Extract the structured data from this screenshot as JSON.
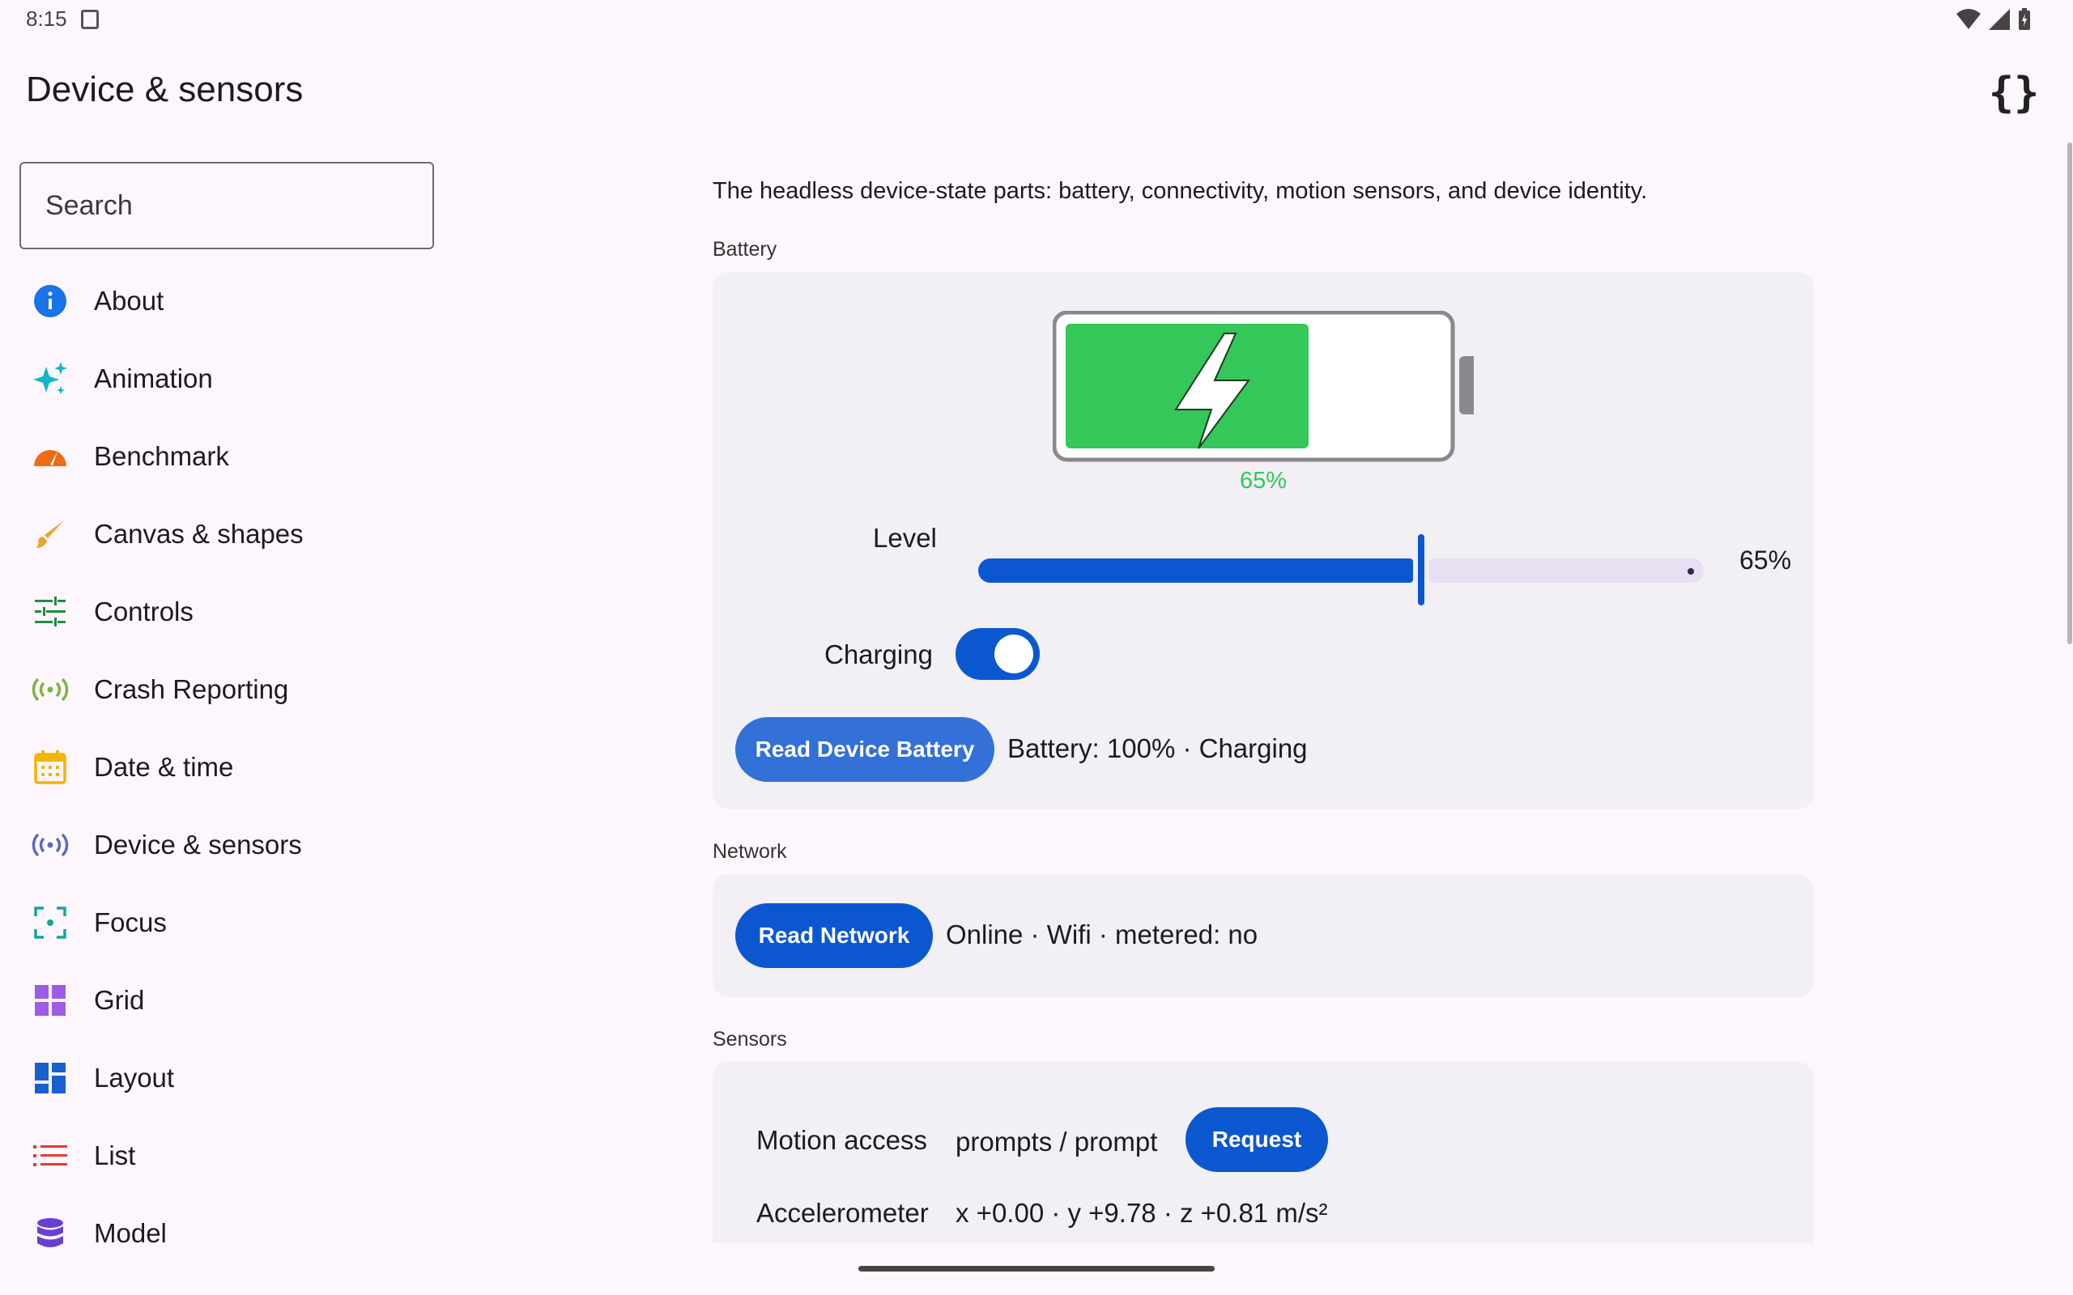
{
  "status_bar": {
    "time": "8:15"
  },
  "app": {
    "title": "Device & sensors"
  },
  "search": {
    "placeholder": "Search"
  },
  "nav": {
    "items": [
      {
        "label": "About",
        "icon": "info-icon",
        "color": "#1a73e8"
      },
      {
        "label": "Animation",
        "icon": "sparkle-icon",
        "color": "#12b5cb"
      },
      {
        "label": "Benchmark",
        "icon": "speedometer-icon",
        "color": "#f06b15"
      },
      {
        "label": "Canvas & shapes",
        "icon": "brush-icon",
        "color": "#f0a030"
      },
      {
        "label": "Controls",
        "icon": "tune-icon",
        "color": "#1e8e3e"
      },
      {
        "label": "Crash Reporting",
        "icon": "broadcast-icon",
        "color": "#7cb342"
      },
      {
        "label": "Date & time",
        "icon": "calendar-icon",
        "color": "#f4b400"
      },
      {
        "label": "Device & sensors",
        "icon": "sensors-icon",
        "color": "#5c6bc0"
      },
      {
        "label": "Focus",
        "icon": "focus-icon",
        "color": "#12a5a0"
      },
      {
        "label": "Grid",
        "icon": "grid-icon",
        "color": "#9c5ce6"
      },
      {
        "label": "Layout",
        "icon": "dashboard-icon",
        "color": "#1a5fd0"
      },
      {
        "label": "List",
        "icon": "list-icon",
        "color": "#e53935"
      },
      {
        "label": "Model",
        "icon": "database-icon",
        "color": "#6a3fd0"
      }
    ]
  },
  "main": {
    "description": "The headless device-state parts: battery, connectivity, motion sensors, and device identity.",
    "battery": {
      "section_label": "Battery",
      "level_percent": 65,
      "percent_label": "65%",
      "level_label": "Level",
      "level_value": "65%",
      "charging_label": "Charging",
      "charging": true,
      "read_button": "Read Device Battery",
      "result": "Battery: 100% · Charging",
      "fill_color": "#34c759"
    },
    "network": {
      "section_label": "Network",
      "read_button": "Read Network",
      "result": "Online · Wifi · metered: no"
    },
    "sensors": {
      "section_label": "Sensors",
      "motion_label": "Motion access",
      "motion_value": "prompts / prompt",
      "request_button": "Request",
      "accel_label": "Accelerometer",
      "accel_value": "x +0.00 · y +9.78 · z +0.81 m/s²"
    }
  },
  "colors": {
    "primary": "#0b57d0",
    "button_light": "#3370d8"
  }
}
